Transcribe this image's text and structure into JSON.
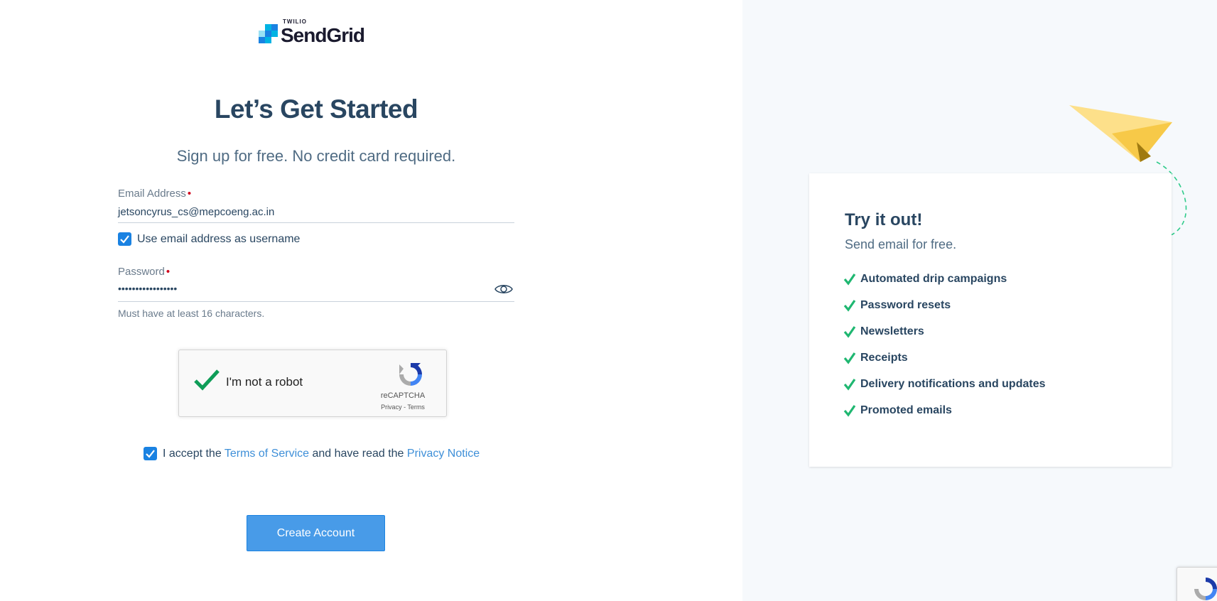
{
  "logo": {
    "top_text": "TWILIO",
    "brand": "SendGrid"
  },
  "header": {
    "title": "Let’s Get Started",
    "subtitle": "Sign up for free. No credit card required."
  },
  "form": {
    "email_label": "Email Address",
    "email_required": "•",
    "email_value": "jetsoncyrus_cs@mepcoeng.ac.in",
    "use_email_as_username_label": "Use email address as username",
    "use_email_as_username_checked": true,
    "password_label": "Password",
    "password_required": "•",
    "password_value": "•••••••••••••••••",
    "password_hint": "Must have at least 16 characters.",
    "terms_prefix": "I accept the ",
    "terms_link": "Terms of Service",
    "terms_middle": " and have read the ",
    "privacy_link": "Privacy Notice",
    "terms_checked": true,
    "submit_label": "Create Account"
  },
  "recaptcha": {
    "label": "I'm not a robot",
    "brand": "reCAPTCHA",
    "privacy": "Privacy",
    "separator": " - ",
    "terms": "Terms",
    "checked": true
  },
  "promo": {
    "title": "Try it out!",
    "subtitle": "Send email for free.",
    "features": [
      "Automated drip campaigns",
      "Password resets",
      "Newsletters",
      "Receipts",
      "Delivery notifications and updates",
      "Promoted emails"
    ]
  },
  "colors": {
    "accent": "#1a82e2",
    "button": "#489be8",
    "heading": "#294661",
    "check_green": "#1fb771",
    "link": "#3e8fd8",
    "right_bg": "#f6f9fc",
    "plane": "#f9c74f"
  },
  "icons": [
    "sendgrid-logo-icon",
    "checkbox-icon",
    "eye-icon",
    "recaptcha-check-icon",
    "recaptcha-logo-icon",
    "green-check-icon",
    "paper-plane-icon"
  ]
}
